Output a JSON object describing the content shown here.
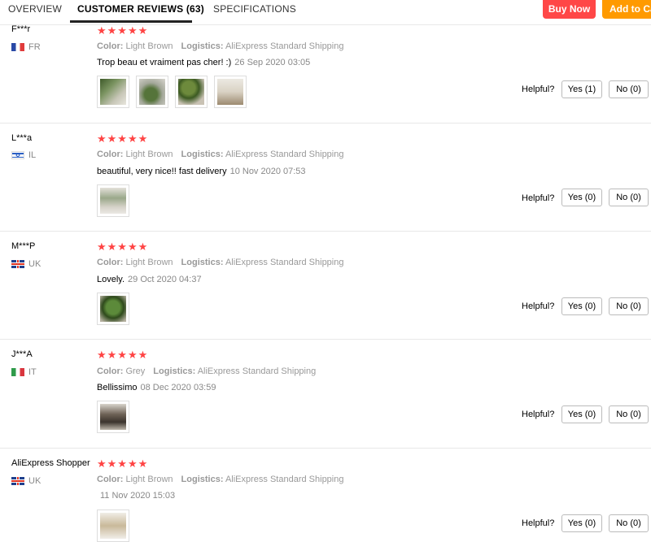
{
  "tabs": [
    {
      "label": "OVERVIEW"
    },
    {
      "label": "CUSTOMER REVIEWS (63)"
    },
    {
      "label": "SPECIFICATIONS"
    }
  ],
  "actions": {
    "buy_now": "Buy Now",
    "add_to_cart": "Add to Ca"
  },
  "labels": {
    "color": "Color:",
    "logistics": "Logistics:",
    "helpful": "Helpful?"
  },
  "reviews": [
    {
      "name": "F***r",
      "country": "FR",
      "flag": "flag-fr",
      "rating": 5,
      "color": "Light Brown",
      "logistics": "AliExpress Standard Shipping",
      "text": "Trop beau et vraiment pas cher! :)",
      "date": "26 Sep 2020 03:05",
      "yes": "Yes (1)",
      "no": "No (0)"
    },
    {
      "name": "L***a",
      "country": "IL",
      "flag": "flag-il",
      "rating": 5,
      "color": "Light Brown",
      "logistics": "AliExpress Standard Shipping",
      "text": "beautiful, very nice!! fast delivery",
      "date": "10 Nov 2020 07:53",
      "yes": "Yes (0)",
      "no": "No (0)"
    },
    {
      "name": "M***P",
      "country": "UK",
      "flag": "flag-uk",
      "rating": 5,
      "color": "Light Brown",
      "logistics": "AliExpress Standard Shipping",
      "text": "Lovely.",
      "date": "29 Oct 2020 04:37",
      "yes": "Yes (0)",
      "no": "No (0)"
    },
    {
      "name": "J***A",
      "country": "IT",
      "flag": "flag-it",
      "rating": 5,
      "color": "Grey",
      "logistics": "AliExpress Standard Shipping",
      "text": "Bellissimo",
      "date": "08 Dec 2020 03:59",
      "yes": "Yes (0)",
      "no": "No (0)"
    },
    {
      "name": "AliExpress Shopper",
      "country": "UK",
      "flag": "flag-uk",
      "rating": 5,
      "color": "Light Brown",
      "logistics": "AliExpress Standard Shipping",
      "text": "",
      "date": "11 Nov 2020 15:03",
      "yes": "Yes (0)",
      "no": "No (0)"
    }
  ],
  "stars_glyph": "★★★★★"
}
